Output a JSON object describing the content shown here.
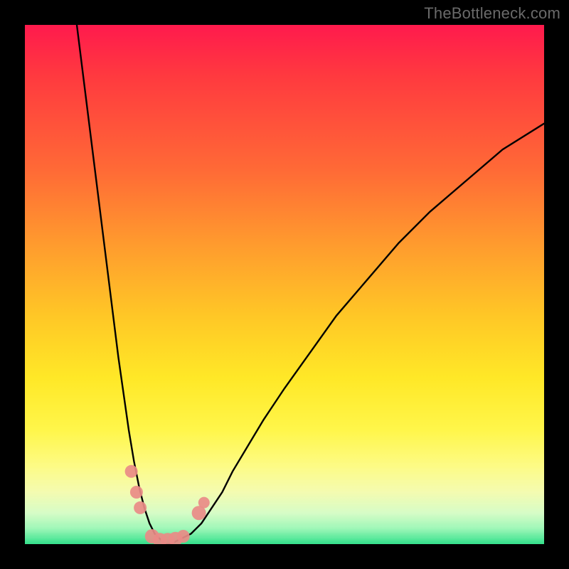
{
  "watermark": "TheBottleneck.com",
  "chart_data": {
    "type": "line",
    "title": "",
    "xlabel": "",
    "ylabel": "",
    "xlim": [
      0,
      100
    ],
    "ylim": [
      0,
      100
    ],
    "grid": false,
    "series": [
      {
        "name": "bottleneck-curve",
        "color": "#000000",
        "x": [
          10,
          11,
          12,
          13,
          14,
          15,
          16,
          17,
          18,
          19,
          20,
          21,
          22,
          23,
          24,
          25,
          26,
          27,
          28,
          30,
          32,
          34,
          36,
          38,
          40,
          43,
          46,
          50,
          55,
          60,
          66,
          72,
          78,
          85,
          92,
          100
        ],
        "y": [
          100,
          92,
          84,
          76,
          68,
          60,
          52,
          44,
          36,
          29,
          22,
          16,
          11,
          7,
          4,
          2,
          1,
          0,
          0,
          1,
          2,
          4,
          7,
          10,
          14,
          19,
          24,
          30,
          37,
          44,
          51,
          58,
          64,
          70,
          76,
          81
        ]
      }
    ],
    "markers": [
      {
        "name": "left-cluster-point-1",
        "x": 20.5,
        "y": 14,
        "r": 9,
        "color": "#e98b87"
      },
      {
        "name": "left-cluster-point-2",
        "x": 21.5,
        "y": 10,
        "r": 9,
        "color": "#e98b87"
      },
      {
        "name": "left-cluster-point-3",
        "x": 22.2,
        "y": 7,
        "r": 9,
        "color": "#e98b87"
      },
      {
        "name": "valley-point-1",
        "x": 24.5,
        "y": 1.5,
        "r": 10,
        "color": "#e98b87"
      },
      {
        "name": "valley-point-2",
        "x": 26.0,
        "y": 0.8,
        "r": 10,
        "color": "#e98b87"
      },
      {
        "name": "valley-point-3",
        "x": 27.5,
        "y": 0.8,
        "r": 10,
        "color": "#e98b87"
      },
      {
        "name": "valley-point-4",
        "x": 29.0,
        "y": 1.0,
        "r": 10,
        "color": "#e98b87"
      },
      {
        "name": "valley-point-5",
        "x": 30.5,
        "y": 1.5,
        "r": 9,
        "color": "#e98b87"
      },
      {
        "name": "right-cluster-point-1",
        "x": 33.5,
        "y": 6,
        "r": 10,
        "color": "#e98b87"
      },
      {
        "name": "right-cluster-point-2",
        "x": 34.5,
        "y": 8,
        "r": 8,
        "color": "#e98b87"
      }
    ],
    "background_gradient_stops": [
      {
        "pos": 0.0,
        "color": "#ff1a4d"
      },
      {
        "pos": 0.4,
        "color": "#ff8a30"
      },
      {
        "pos": 0.7,
        "color": "#ffe827"
      },
      {
        "pos": 0.92,
        "color": "#e8fbc0"
      },
      {
        "pos": 1.0,
        "color": "#32e08a"
      }
    ]
  }
}
